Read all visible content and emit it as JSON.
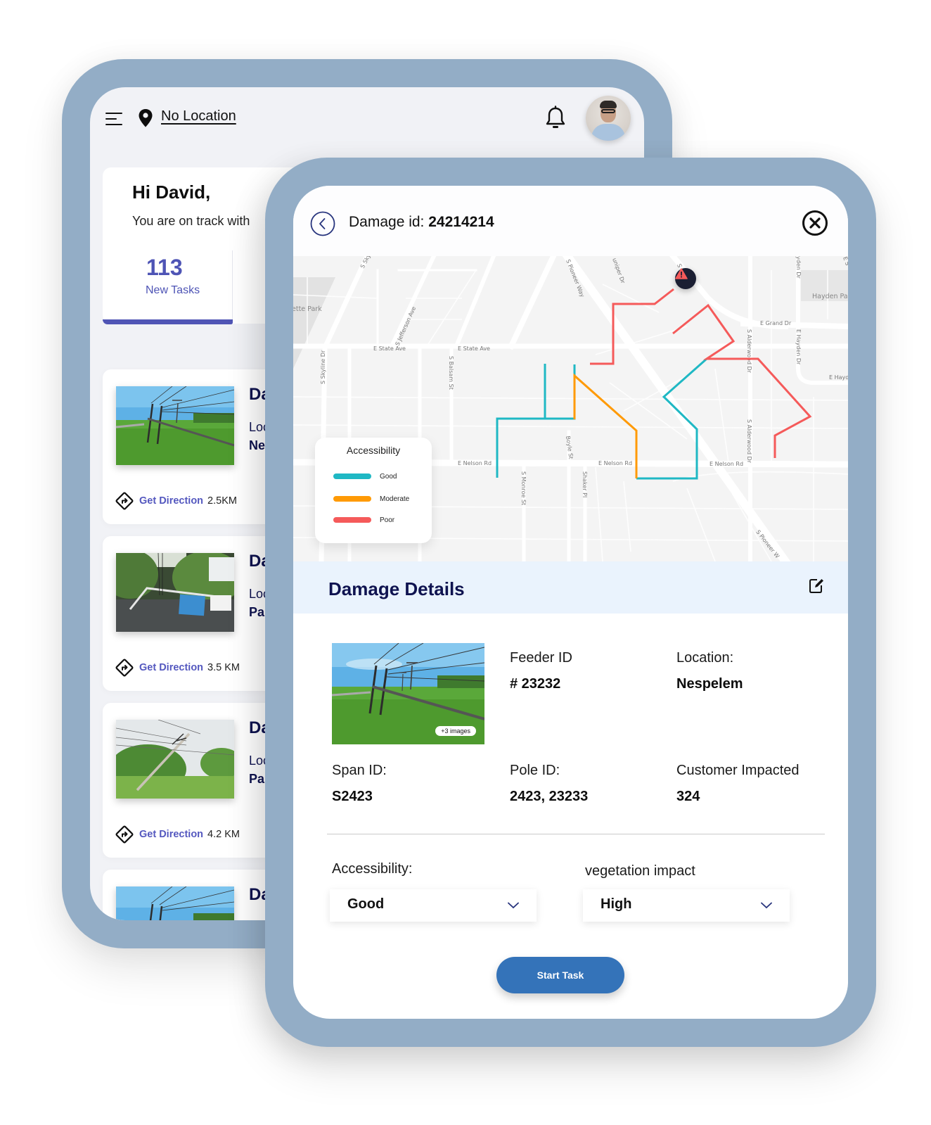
{
  "home": {
    "location_label": "No Location",
    "greeting_title": "Hi David,",
    "greeting_subtitle": "You are on track with",
    "stats": [
      {
        "value": "113",
        "label": "New Tasks"
      }
    ],
    "tasks": [
      {
        "title": "Da",
        "location_label": "Loc",
        "location_value": "Ne",
        "direction_label": "Get Direction",
        "distance": "2.5KM",
        "photo": "fallen-pole-field"
      },
      {
        "title": "Da",
        "location_label": "Loc",
        "location_value": "Pa",
        "direction_label": "Get Direction",
        "distance": "3.5 KM",
        "photo": "fallen-pole-street"
      },
      {
        "title": "Da",
        "location_label": "Loc",
        "location_value": "Pa",
        "direction_label": "Get Direction",
        "distance": "4.2 KM",
        "photo": "leaning-pole-trees"
      },
      {
        "title": "Da",
        "location_label": "",
        "location_value": "",
        "direction_label": "",
        "distance": "",
        "photo": "fallen-pole-field"
      }
    ]
  },
  "detail": {
    "damage_id_label": "Damage id:",
    "damage_id": "24214214",
    "map": {
      "legend_title": "Accessibility",
      "legend": [
        {
          "label": "Good",
          "color": "#1fb8c4"
        },
        {
          "label": "Moderate",
          "color": "#ff9a05"
        },
        {
          "label": "Poor",
          "color": "#f55a5a"
        }
      ],
      "streets": {
        "s_sky": "S Sky",
        "park": "ette Park",
        "jefferson": "S Jefferson Ave",
        "state_1": "E State Ave",
        "state_2": "E State Ave",
        "skyline": "S Skyline Dr",
        "balsam": "S Balsam St",
        "pioneer_way": "S Pioneer Way",
        "juniper": "uniper Dr",
        "s_c": "S C",
        "hayden_dr_top": "yden Dr",
        "hayden_park": "Hayden Par",
        "e_top": "E S",
        "grand": "E Grand Dr",
        "alderwood_1": "S Alderwood Dr",
        "hayden_dr": "E Hayden Dr",
        "e_hayd": "E Hayd",
        "nelson_1": "E Nelson Rd",
        "nelson_2": "E Nelson Rd",
        "nelson_3": "E Nelson Rd",
        "monroe": "S Monroe St",
        "boyle": "Boyle St",
        "shaker": "Shaker Pl",
        "alderwood_2": "S Alderwood Dr",
        "pioneer_bottom": "S Pioneer W"
      }
    },
    "section_title": "Damage Details",
    "images_badge": "+3 images",
    "fields": {
      "feeder_label": "Feeder ID",
      "feeder_value": "# 23232",
      "location_label": "Location:",
      "location_value": "Nespelem",
      "span_label": "Span ID:",
      "span_value": "S2423",
      "pole_label": "Pole ID:",
      "pole_value": "2423, 23233",
      "customer_label": "Customer Impacted",
      "customer_value": "324"
    },
    "accessibility_label": "Accessibility:",
    "accessibility_value": "Good",
    "vegetation_label": "vegetation impact",
    "vegetation_value": "High",
    "start_button": "Start Task",
    "brand_color": "#3473b9",
    "heading_color": "#0f1350"
  }
}
